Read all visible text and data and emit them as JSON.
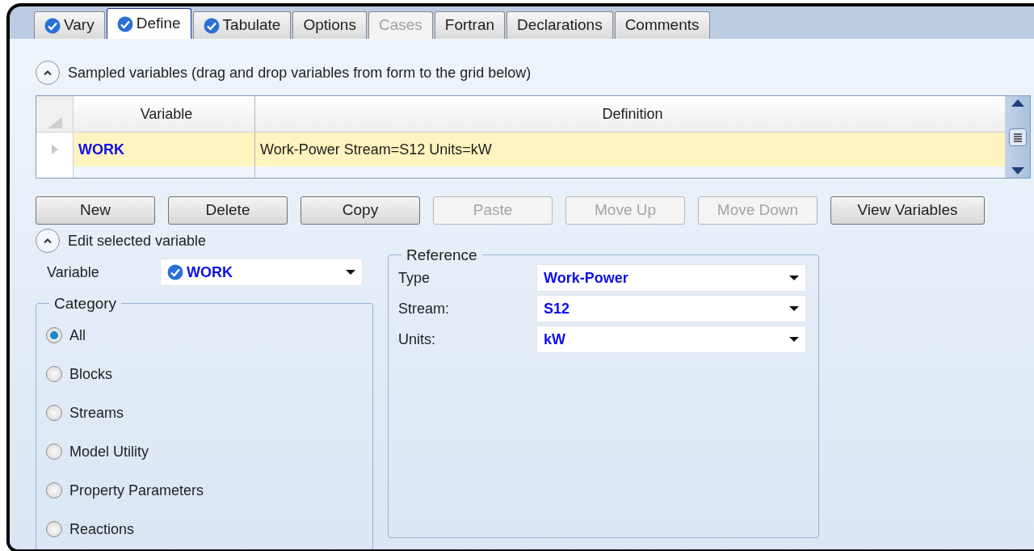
{
  "tabs": [
    {
      "label": "Vary",
      "selected": false,
      "disabled": false,
      "checked": true
    },
    {
      "label": "Define",
      "selected": true,
      "disabled": false,
      "checked": true
    },
    {
      "label": "Tabulate",
      "selected": false,
      "disabled": false,
      "checked": true
    },
    {
      "label": "Options",
      "selected": false,
      "disabled": false,
      "checked": false
    },
    {
      "label": "Cases",
      "selected": false,
      "disabled": true,
      "checked": false
    },
    {
      "label": "Fortran",
      "selected": false,
      "disabled": false,
      "checked": false
    },
    {
      "label": "Declarations",
      "selected": false,
      "disabled": false,
      "checked": false
    },
    {
      "label": "Comments",
      "selected": false,
      "disabled": false,
      "checked": false
    }
  ],
  "sampled_section": {
    "title": "Sampled variables (drag and drop variables from form to the grid below)",
    "expanded": true
  },
  "grid": {
    "columns": [
      "Variable",
      "Definition"
    ],
    "rows": [
      {
        "variable": "WORK",
        "definition": "Work-Power Stream=S12 Units=kW",
        "selected": true
      }
    ]
  },
  "buttons": [
    {
      "label": "New",
      "disabled": false
    },
    {
      "label": "Delete",
      "disabled": false
    },
    {
      "label": "Copy",
      "disabled": false
    },
    {
      "label": "Paste",
      "disabled": true
    },
    {
      "label": "Move Up",
      "disabled": true
    },
    {
      "label": "Move Down",
      "disabled": true
    },
    {
      "label": "View Variables",
      "disabled": false
    }
  ],
  "edit_section": {
    "title": "Edit selected variable",
    "expanded": true
  },
  "variable_field": {
    "label": "Variable",
    "value": "WORK",
    "checked": true
  },
  "category": {
    "legend": "Category",
    "options": [
      {
        "label": "All",
        "selected": true
      },
      {
        "label": "Blocks",
        "selected": false
      },
      {
        "label": "Streams",
        "selected": false
      },
      {
        "label": "Model Utility",
        "selected": false
      },
      {
        "label": "Property Parameters",
        "selected": false
      },
      {
        "label": "Reactions",
        "selected": false
      }
    ]
  },
  "reference": {
    "legend": "Reference",
    "fields": [
      {
        "label": "Type",
        "value": "Work-Power"
      },
      {
        "label": "Stream:",
        "value": "S12"
      },
      {
        "label": "Units:",
        "value": "kW"
      }
    ]
  }
}
